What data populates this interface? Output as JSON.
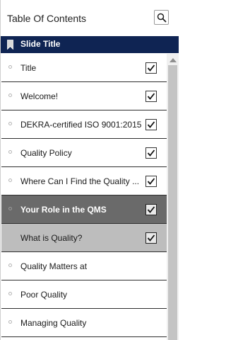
{
  "header": {
    "title": "Table Of Contents",
    "search_icon": "search-icon"
  },
  "column": {
    "label": "Slide Title",
    "icon": "bookmark-icon"
  },
  "colors": {
    "header_bar": "#0f2453",
    "active_row": "#6a6a6a",
    "selected_row": "#bdbdbd"
  },
  "items": [
    {
      "label": "Title",
      "checked": true,
      "state": "normal"
    },
    {
      "label": "Welcome!",
      "checked": true,
      "state": "normal"
    },
    {
      "label": "DEKRA-certified ISO 9001:2015",
      "checked": true,
      "state": "normal"
    },
    {
      "label": "Quality Policy",
      "checked": true,
      "state": "normal"
    },
    {
      "label": "Where Can I Find the Quality ...",
      "checked": true,
      "state": "normal"
    },
    {
      "label": "Your Role in the QMS",
      "checked": true,
      "state": "active"
    },
    {
      "label": "What is Quality?",
      "checked": true,
      "state": "selected"
    },
    {
      "label": "Quality Matters at",
      "checked": false,
      "state": "normal"
    },
    {
      "label": "Poor Quality",
      "checked": false,
      "state": "normal"
    },
    {
      "label": "Managing Quality",
      "checked": false,
      "state": "normal"
    }
  ]
}
